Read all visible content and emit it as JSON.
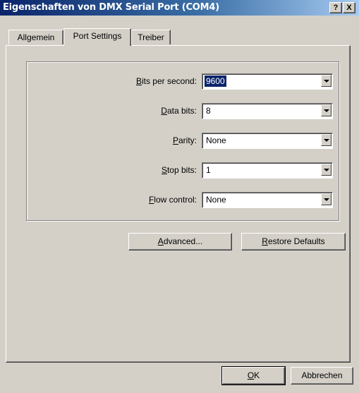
{
  "window": {
    "title": "Eigenschaften von DMX Serial Port (COM4)",
    "help_label": "?",
    "close_label": "X"
  },
  "tabs": [
    {
      "label": "Allgemein"
    },
    {
      "label": "Port Settings"
    },
    {
      "label": "Treiber"
    }
  ],
  "settings": [
    {
      "accel": "B",
      "rest": "its per second:",
      "value": "9600",
      "selected": true
    },
    {
      "accel": "D",
      "rest": "ata bits:",
      "value": "8"
    },
    {
      "accel": "P",
      "rest": "arity:",
      "value": "None"
    },
    {
      "accel": "S",
      "rest": "top bits:",
      "value": "1"
    },
    {
      "accel": "F",
      "rest": "low control:",
      "value": "None"
    }
  ],
  "buttons": {
    "advanced": {
      "accel": "A",
      "rest": "dvanced..."
    },
    "restore": {
      "accel": "R",
      "rest": "estore Defaults"
    },
    "ok": {
      "accel": "O",
      "rest": "K"
    },
    "cancel": {
      "label": "Abbrechen"
    }
  }
}
